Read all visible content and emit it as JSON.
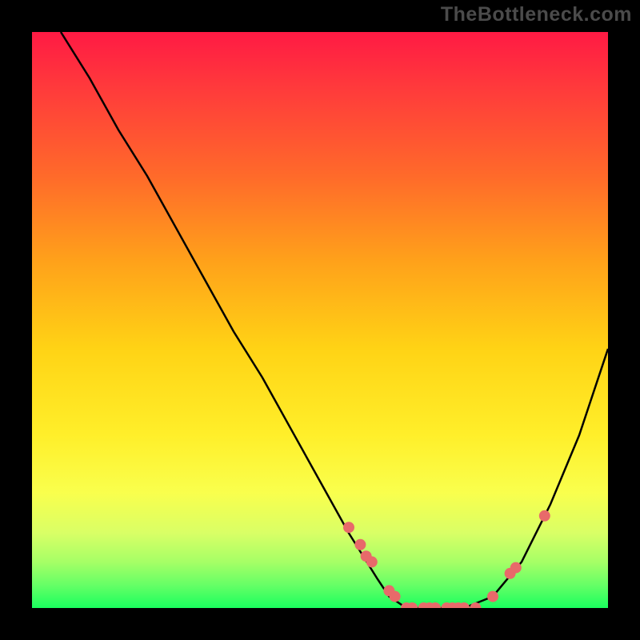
{
  "watermark": "TheBottleneck.com",
  "chart_data": {
    "type": "line",
    "title": "",
    "xlabel": "",
    "ylabel": "",
    "xlim": [
      0,
      100
    ],
    "ylim": [
      0,
      100
    ],
    "background_gradient": {
      "top_color": "#ff1a44",
      "mid_color": "#ffd315",
      "bottom_color": "#1aff5e",
      "description": "vertical rainbow gradient, red at top through orange/yellow to green at bottom"
    },
    "series": [
      {
        "name": "bottleneck-curve",
        "color": "#000000",
        "x": [
          5,
          10,
          15,
          20,
          25,
          30,
          35,
          40,
          45,
          50,
          55,
          60,
          62,
          65,
          70,
          75,
          80,
          85,
          90,
          95,
          100
        ],
        "y": [
          100,
          92,
          83,
          75,
          66,
          57,
          48,
          40,
          31,
          22,
          13,
          5,
          2,
          0,
          0,
          0,
          2,
          8,
          18,
          30,
          45
        ]
      },
      {
        "name": "highlight-points",
        "color": "#e86a6a",
        "style": "points",
        "x": [
          55,
          57,
          58,
          59,
          62,
          63,
          65,
          66,
          68,
          69,
          70,
          72,
          73,
          74,
          75,
          77,
          80,
          83,
          84,
          89
        ],
        "y": [
          14,
          11,
          9,
          8,
          3,
          2,
          0,
          0,
          0,
          0,
          0,
          0,
          0,
          0,
          0,
          0,
          2,
          6,
          7,
          16
        ]
      }
    ]
  }
}
